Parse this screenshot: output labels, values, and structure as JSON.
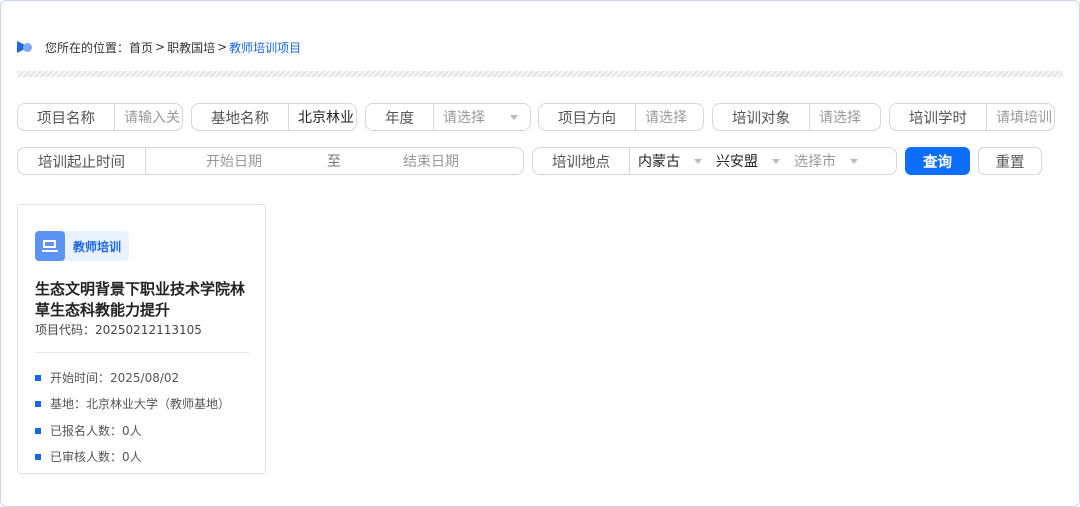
{
  "breadcrumb": {
    "prefix": "您所在的位置：",
    "items": [
      "首页",
      "职教国培",
      "教师培训项目"
    ],
    "separator": ">"
  },
  "filters": {
    "project_name": {
      "label": "项目名称",
      "placeholder": "请输入关"
    },
    "base_name": {
      "label": "基地名称",
      "value": "北京林业"
    },
    "year": {
      "label": "年度",
      "placeholder": "请选择"
    },
    "direction": {
      "label": "项目方向",
      "placeholder": "请选择"
    },
    "target": {
      "label": "培训对象",
      "placeholder": "请选择"
    },
    "hours": {
      "label": "培训学时",
      "placeholder": "请填培训"
    },
    "period": {
      "label": "培训起止时间",
      "start_placeholder": "开始日期",
      "to": "至",
      "end_placeholder": "结束日期"
    },
    "location": {
      "label": "培训地点",
      "province": "内蒙古",
      "league": "兴安盟",
      "city_placeholder": "选择市"
    }
  },
  "buttons": {
    "query": "查询",
    "reset": "重置"
  },
  "card": {
    "tag": "教师培训",
    "title": "生态文明背景下职业技术学院林草生态科教能力提升",
    "code": "项目代码：20250212113105",
    "meta": [
      "开始时间：2025/08/02",
      "基地：北京林业大学（教师基地）",
      "已报名人数：0人",
      "已审核人数：0人"
    ]
  },
  "colors": {
    "accent": "#1a66e6",
    "button": "#0d6efd"
  },
  "icons": {
    "breadcrumb": "location-flag-icon",
    "tag": "teacher-board-icon"
  }
}
